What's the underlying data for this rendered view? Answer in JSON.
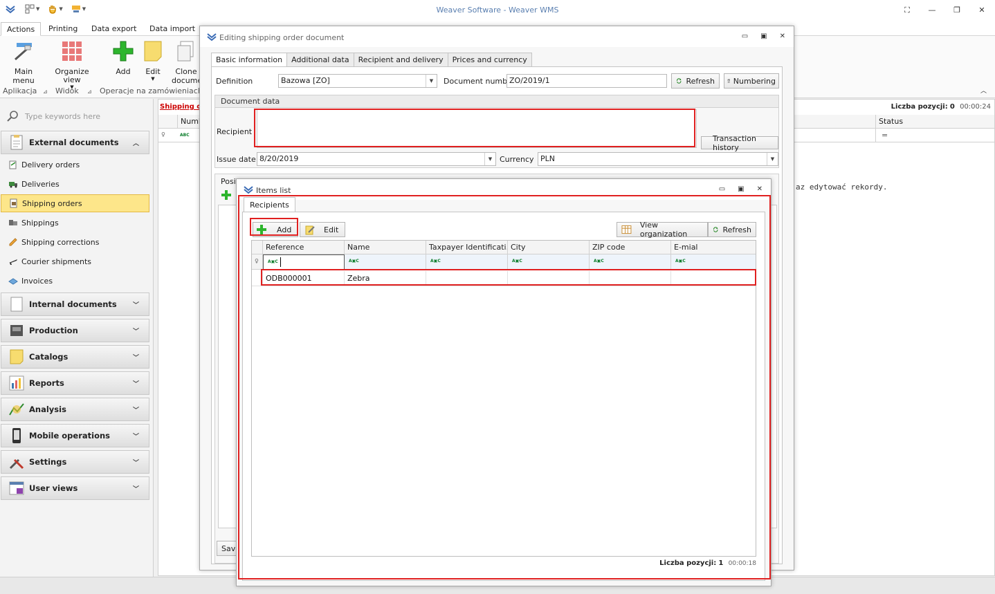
{
  "app": {
    "title": "Weaver Software - Weaver WMS"
  },
  "ribbon": {
    "tabs": [
      "Actions",
      "Printing",
      "Data export",
      "Data import"
    ],
    "buttons": {
      "main_menu": "Main menu",
      "organize_view_1": "Organize",
      "organize_view_2": "view",
      "add": "Add",
      "edit": "Edit",
      "clone_1": "Clone",
      "clone_2": "documen"
    },
    "groups": {
      "aplikacja": "Aplikacja",
      "widok": "Widok",
      "operacje": "Operacje na zamówieniach od"
    }
  },
  "nav": {
    "search_placeholder": "Type keywords here",
    "groups": [
      {
        "label": "External documents",
        "expanded": true
      },
      {
        "label": "Internal documents"
      },
      {
        "label": "Production"
      },
      {
        "label": "Catalogs"
      },
      {
        "label": "Reports"
      },
      {
        "label": "Analysis"
      },
      {
        "label": "Mobile operations"
      },
      {
        "label": "Settings"
      },
      {
        "label": "User views"
      }
    ],
    "items": [
      {
        "label": "Delivery orders"
      },
      {
        "label": "Deliveries"
      },
      {
        "label": "Shipping orders",
        "selected": true
      },
      {
        "label": "Shippings"
      },
      {
        "label": "Shipping corrections"
      },
      {
        "label": "Courier shipments"
      },
      {
        "label": "Invoices"
      }
    ]
  },
  "main": {
    "link": "Shipping or",
    "liczba_label": "Liczba pozycji:",
    "liczba_value": "0",
    "time": "00:00:24",
    "col_number": "Numb",
    "col_status": "Status",
    "status_filter": "=",
    "message": "az edytować rekordy."
  },
  "editing_dialog": {
    "title": "Editing shipping order document",
    "tabs": [
      "Basic information",
      "Additional data",
      "Recipient and delivery",
      "Prices and currency"
    ],
    "definition_label": "Definition",
    "definition_value": "Bazowa [ZO]",
    "docnum_label": "Document number",
    "docnum_value": "ZO/2019/1",
    "refresh_label": "Refresh",
    "numbering_label": "Numbering",
    "section_label": "Document data",
    "recipient_label": "Recipient",
    "transaction_history_label": "Transaction history",
    "issue_date_label": "Issue date",
    "issue_date_value": "8/20/2019",
    "currency_label": "Currency",
    "currency_value": "PLN",
    "positions_label": "Posi",
    "save_label": "Save,"
  },
  "items_dialog": {
    "title": "Items list",
    "tab": "Recipients",
    "add_label": "Add",
    "edit_label": "Edit",
    "view_org_label": "View organization",
    "refresh_label": "Refresh",
    "columns": [
      "Reference",
      "Name",
      "Taxpayer Identificati...",
      "City",
      "ZIP code",
      "E-mial"
    ],
    "rows": [
      {
        "reference": "ODB000001",
        "name": "Zebra",
        "tax": "",
        "city": "",
        "zip": "",
        "email": ""
      }
    ],
    "liczba_label": "Liczba pozycji:",
    "liczba_value": "1",
    "time": "00:00:18"
  },
  "colors": {
    "highlight_red": "#e02020",
    "selected_nav": "#fde68a",
    "link_red": "#cc0000",
    "title_blue": "#5a7fb0"
  }
}
